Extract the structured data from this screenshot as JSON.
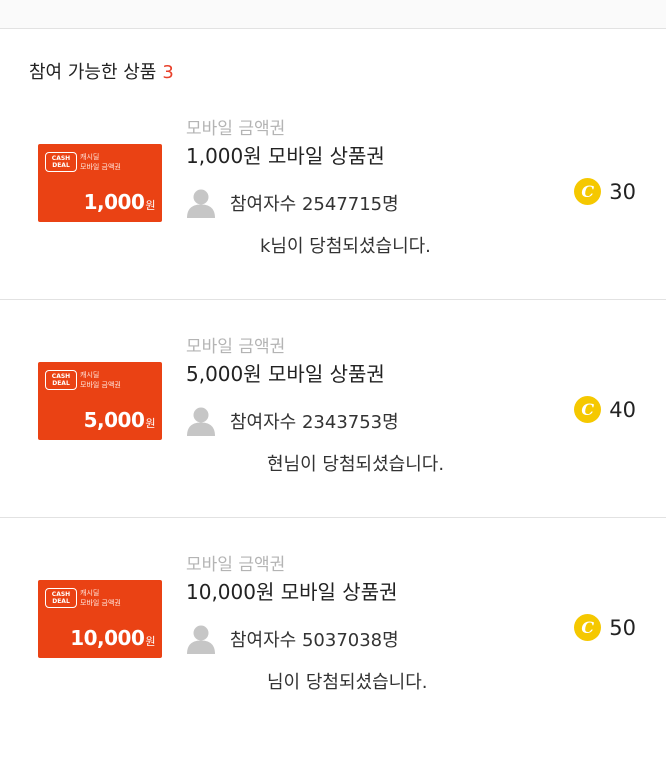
{
  "header": {
    "label": "참여 가능한 상품",
    "count": "3"
  },
  "card_brand": {
    "logo": "CASH DEAL",
    "subtitle_line1": "캐시딜",
    "subtitle_line2": "모바일 금액권"
  },
  "items": [
    {
      "category": "모바일 금액권",
      "title": "1,000원 모바일 상품권",
      "card_amount": "1,000",
      "card_unit": "원",
      "participants": "참여자수 2547715명",
      "winner": "k님이 당첨되셨습니다.",
      "cost": "30"
    },
    {
      "category": "모바일 금액권",
      "title": "5,000원 모바일 상품권",
      "card_amount": "5,000",
      "card_unit": "원",
      "participants": "참여자수 2343753명",
      "winner": "현님이 당첨되셨습니다.",
      "cost": "40"
    },
    {
      "category": "모바일 금액권",
      "title": "10,000원 모바일 상품권",
      "card_amount": "10,000",
      "card_unit": "원",
      "participants": "참여자수 5037038명",
      "winner": "님이 당첨되셨습니다.",
      "cost": "50"
    }
  ],
  "icons": {
    "user": "user-icon",
    "coin": "coin-icon",
    "coin_glyph": "C"
  },
  "colors": {
    "accent": "#e8402a",
    "card": "#ea4214",
    "coin": "#f5c800",
    "muted": "#b4b4b4"
  }
}
